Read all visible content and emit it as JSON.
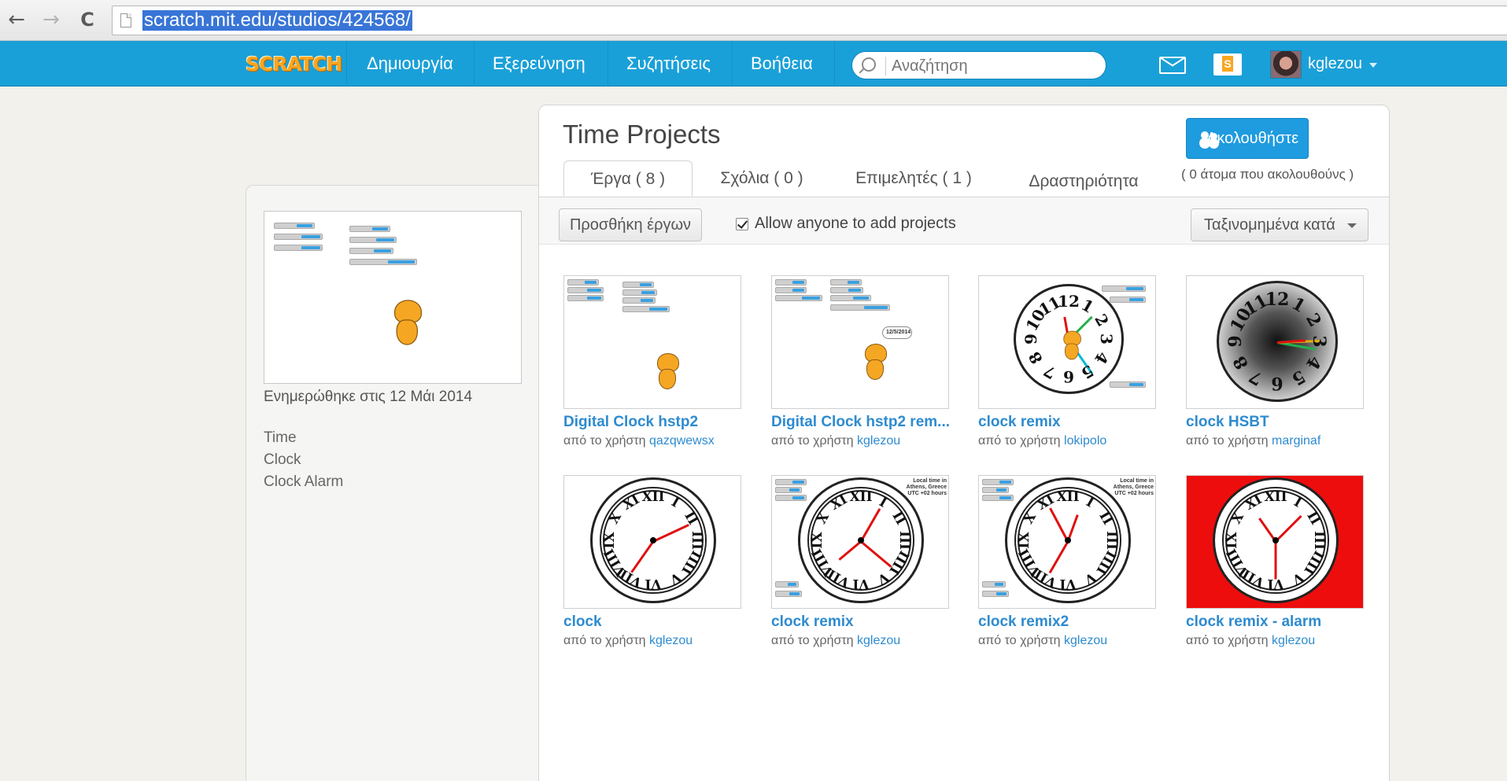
{
  "browser": {
    "url": "scratch.mit.edu/studios/424568/",
    "back_icon": "←",
    "forward_icon": "→",
    "reload_icon": "C"
  },
  "topnav": {
    "logo": "SCRATCH",
    "items": [
      "Δημιουργία",
      "Εξερεύνηση",
      "Συζητήσεις",
      "Βοήθεια"
    ],
    "search_placeholder": "Αναζήτηση",
    "username": "kglezou"
  },
  "sidebar": {
    "updated": "Ενημερώθηκε στις 12 Μάι 2014",
    "tags": [
      "Time",
      "Clock",
      "Clock Alarm"
    ]
  },
  "studio": {
    "title": "Time Projects",
    "follow_label": "Ακολουθήστε",
    "followers": "( 0 άτομα που ακολουθούνς )",
    "tabs": [
      "Έργα ( 8 )",
      "Σχόλια ( 0 )",
      "Επιμελητές ( 1 )",
      "Δραστηριότητα"
    ],
    "add_projects": "Προσθήκη έργων",
    "allow_label": "Allow anyone to add projects",
    "sort_label": "Ταξινομημένα κατά",
    "by_prefix": "από το χρήστη"
  },
  "projects": [
    {
      "title": "Digital Clock hstp2",
      "author": "qazqwewsx",
      "thumb": "digital-cat"
    },
    {
      "title": "Digital Clock hstp2 rem...",
      "author": "kglezou",
      "thumb": "digital-cat-bubble",
      "bubble": "12/5/2014"
    },
    {
      "title": "clock remix",
      "author": "lokipolo",
      "thumb": "arabic-clock"
    },
    {
      "title": "clock HSBT",
      "author": "marginaf",
      "thumb": "gradient-clock"
    },
    {
      "title": "clock",
      "author": "kglezou",
      "thumb": "roman-clock"
    },
    {
      "title": "clock remix",
      "author": "kglezou",
      "thumb": "roman-clock-vars",
      "label": "Local time in Athens, Greece UTC +02 hours"
    },
    {
      "title": "clock remix2",
      "author": "kglezou",
      "thumb": "roman-clock-vars",
      "label": "Local time in Athens, Greece UTC +02 hours"
    },
    {
      "title": "clock remix - alarm",
      "author": "kglezou",
      "thumb": "roman-clock-red"
    }
  ],
  "clock_numerals_roman": [
    "XII",
    "I",
    "II",
    "III",
    "IIII",
    "V",
    "VI",
    "VII",
    "VIII",
    "IX",
    "X",
    "XI"
  ],
  "clock_numerals_arabic": [
    "12",
    "1",
    "2",
    "3",
    "4",
    "5",
    "6",
    "7",
    "8",
    "9",
    "10",
    "11"
  ],
  "colors": {
    "accent": "#1aa0d8",
    "link": "#2d8bd0",
    "follow": "#1f9bdf",
    "alarm_bg": "#ee0d0d"
  }
}
